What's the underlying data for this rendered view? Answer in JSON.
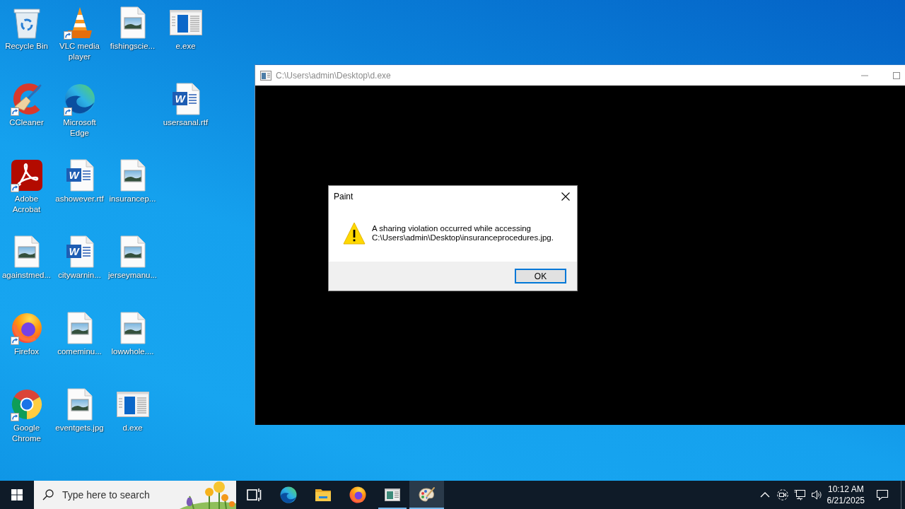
{
  "desktop_icons": [
    {
      "kind": "recycle-bin",
      "label": "Recycle Bin",
      "shortcut": false
    },
    {
      "kind": "ccleaner",
      "label": "CCleaner",
      "shortcut": true
    },
    {
      "kind": "acrobat",
      "label": "Adobe Acrobat",
      "shortcut": true
    },
    {
      "kind": "image",
      "label": "againstmed...",
      "shortcut": false
    },
    {
      "kind": "firefox",
      "label": "Firefox",
      "shortcut": true
    },
    {
      "kind": "chrome",
      "label": "Google Chrome",
      "shortcut": true
    },
    {
      "kind": "vlc",
      "label": "VLC media player",
      "shortcut": true
    },
    {
      "kind": "edge",
      "label": "Microsoft Edge",
      "shortcut": true
    },
    {
      "kind": "word",
      "label": "ashowever.rtf",
      "shortcut": false,
      "glyph": "W"
    },
    {
      "kind": "word",
      "label": "citywarnin...",
      "shortcut": false,
      "glyph": "W"
    },
    {
      "kind": "image",
      "label": "comeminu...",
      "shortcut": false
    },
    {
      "kind": "image",
      "label": "eventgets.jpg",
      "shortcut": false
    },
    {
      "kind": "image",
      "label": "fishingscie...",
      "shortcut": false
    },
    {
      "kind": "image",
      "label": "insurancep...",
      "shortcut": false
    },
    {
      "kind": "image",
      "label": "jerseymanu...",
      "shortcut": false
    },
    {
      "kind": "image",
      "label": "lowwhole....",
      "shortcut": false
    },
    {
      "kind": "exe",
      "label": "d.exe",
      "shortcut": false
    },
    {
      "kind": "exe",
      "label": "e.exe",
      "shortcut": false
    },
    {
      "kind": "word",
      "label": "usersanal.rtf",
      "shortcut": false,
      "glyph": "W"
    }
  ],
  "console_window": {
    "title": "C:\\Users\\admin\\Desktop\\d.exe",
    "active": false
  },
  "dialog": {
    "title": "Paint",
    "message": "A sharing violation occurred while accessing\nC:\\Users\\admin\\Desktop\\insuranceprocedures.jpg.",
    "buttons": [
      {
        "label": "OK",
        "focused": true
      }
    ]
  },
  "taskbar": {
    "search": {
      "placeholder": "Type here to search"
    },
    "apps": [
      {
        "kind": "task-view",
        "running": false,
        "selected": false
      },
      {
        "kind": "edge",
        "running": false,
        "selected": false
      },
      {
        "kind": "explorer",
        "running": false,
        "selected": false
      },
      {
        "kind": "firefox",
        "running": false,
        "selected": false
      },
      {
        "kind": "console",
        "running": true,
        "selected": false
      },
      {
        "kind": "paint",
        "running": true,
        "selected": true
      }
    ],
    "tray": {
      "icons": [
        {
          "kind": "chevron"
        },
        {
          "kind": "meet-now"
        },
        {
          "kind": "network"
        },
        {
          "kind": "volume"
        }
      ],
      "time": "10:12 AM",
      "date": "6/21/2025"
    }
  }
}
